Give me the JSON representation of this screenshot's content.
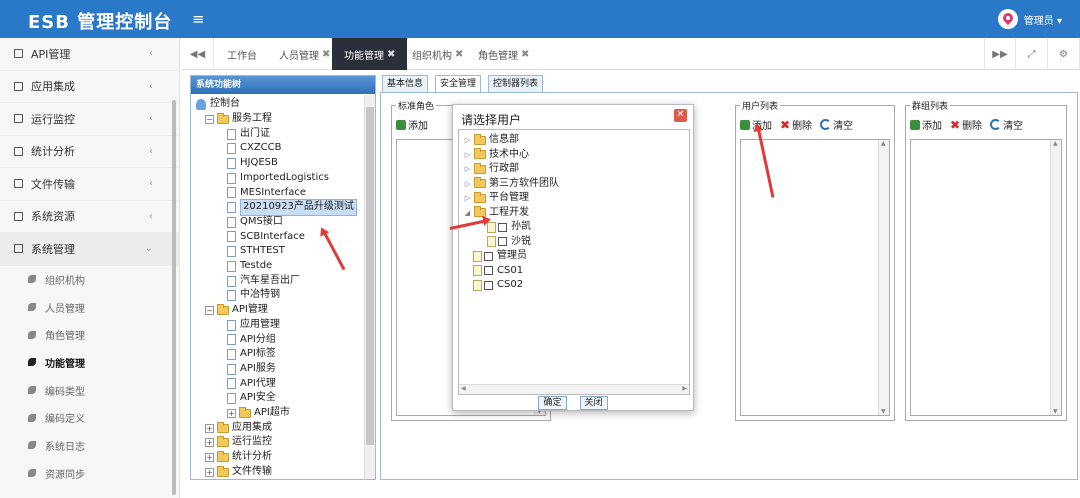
{
  "header": {
    "title": "ESB 管理控制台",
    "user": "管理员 ▾"
  },
  "sidebar": {
    "menus": [
      {
        "label": "API管理"
      },
      {
        "label": "应用集成"
      },
      {
        "label": "运行监控"
      },
      {
        "label": "统计分析"
      },
      {
        "label": "文件传输"
      },
      {
        "label": "系统资源"
      },
      {
        "label": "系统管理"
      }
    ],
    "subitems": [
      {
        "label": "组织机构"
      },
      {
        "label": "人员管理"
      },
      {
        "label": "角色管理"
      },
      {
        "label": "功能管理"
      },
      {
        "label": "编码类型"
      },
      {
        "label": "编码定义"
      },
      {
        "label": "系统日志"
      },
      {
        "label": "资源同步"
      }
    ]
  },
  "tabs": [
    {
      "label": "工作台"
    },
    {
      "label": "人员管理"
    },
    {
      "label": "功能管理"
    },
    {
      "label": "组织机构"
    },
    {
      "label": "角色管理"
    }
  ],
  "tree_panel": {
    "title": "系统功能树",
    "nodes": [
      "控制台",
      "服务工程",
      "出门证",
      "CXZCCB",
      "HJQESB",
      "ImportedLogistics",
      "MESInterface",
      "20210923产品升级测试",
      "QMS接口",
      "SCBInterface",
      "STHTEST",
      "Testde",
      "汽车星吾出厂",
      "中冶特钢",
      "API管理",
      "应用管理",
      "API分组",
      "API标签",
      "API服务",
      "API代理",
      "API安全",
      "API超市",
      "应用集成",
      "运行监控",
      "统计分析",
      "文件传输"
    ]
  },
  "inner_tabs": [
    {
      "label": "基本信息"
    },
    {
      "label": "安全管理"
    },
    {
      "label": "控制器列表"
    }
  ],
  "fieldsets": [
    {
      "legend": "标准角色"
    },
    {
      "legend": "用户列表"
    },
    {
      "legend": "群组列表"
    }
  ],
  "toolbar": {
    "add": "添加",
    "delete": "删除",
    "clear": "清空"
  },
  "dialog": {
    "title": "请选择用户",
    "nodes": [
      "信息部",
      "技术中心",
      "行政部",
      "第三方软件团队",
      "平台管理",
      "工程开发",
      "孙凯",
      "沙锐",
      "管理员",
      "CS01",
      "CS02"
    ],
    "ok": "确定",
    "close": "关闭"
  }
}
